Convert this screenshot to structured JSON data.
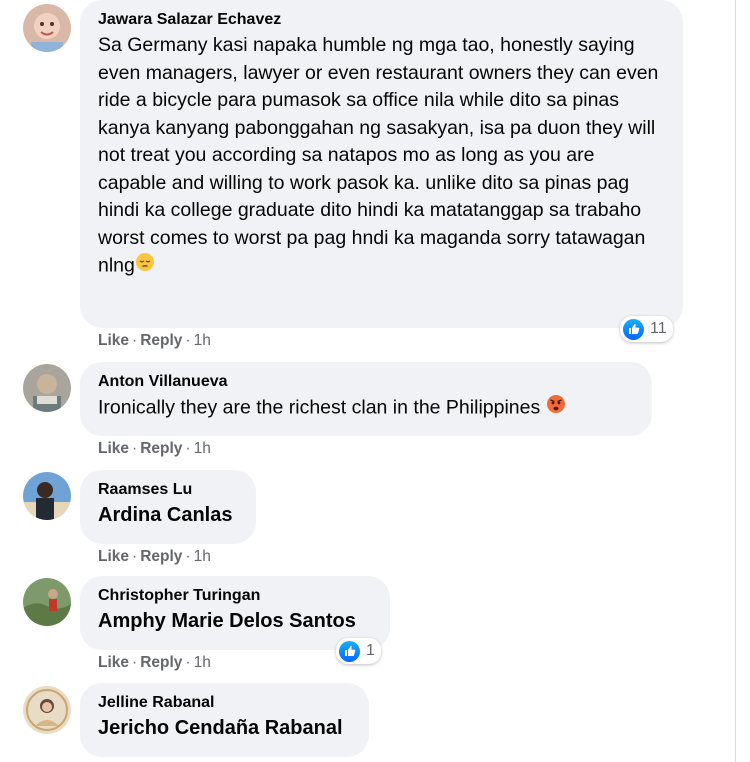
{
  "colors": {
    "bubble_bg": "#f0f2f5",
    "meta_text": "#65676b",
    "like_blue": "#0866ff"
  },
  "comments": [
    {
      "author": "Jawara Salazar Echavez",
      "text": "Sa Germany kasi napaka humble ng mga tao, honestly saying even managers, lawyer or even restaurant owners they can even ride a bicycle para pumasok sa office nila while dito sa pinas kanya kanyang pabonggahan ng sasakyan, isa pa duon they will not treat you according sa natapos mo as long as you are capable and willing to work pasok ka. unlike dito sa pinas pag hindi ka college graduate dito hindi ka matatanggap sa trabaho worst comes to worst pa pag hndi ka maganda sorry tatawagan nlng",
      "emoji": "pensive-face-emoji",
      "like": "Like",
      "reply": "Reply",
      "time": "1h",
      "reaction_count": "11"
    },
    {
      "author": "Anton Villanueva",
      "text": "Ironically they are the richest clan in the Philippines",
      "emoji": "angry-face-emoji",
      "like": "Like",
      "reply": "Reply",
      "time": "1h"
    },
    {
      "author": "Raamses Lu",
      "text": "Ardina Canlas",
      "like": "Like",
      "reply": "Reply",
      "time": "1h"
    },
    {
      "author": "Christopher Turingan",
      "text": "Amphy Marie Delos Santos",
      "like": "Like",
      "reply": "Reply",
      "time": "1h",
      "reaction_count": "1"
    },
    {
      "author": "Jelline Rabanal",
      "text": "Jericho Cendaña Rabanal"
    }
  ]
}
